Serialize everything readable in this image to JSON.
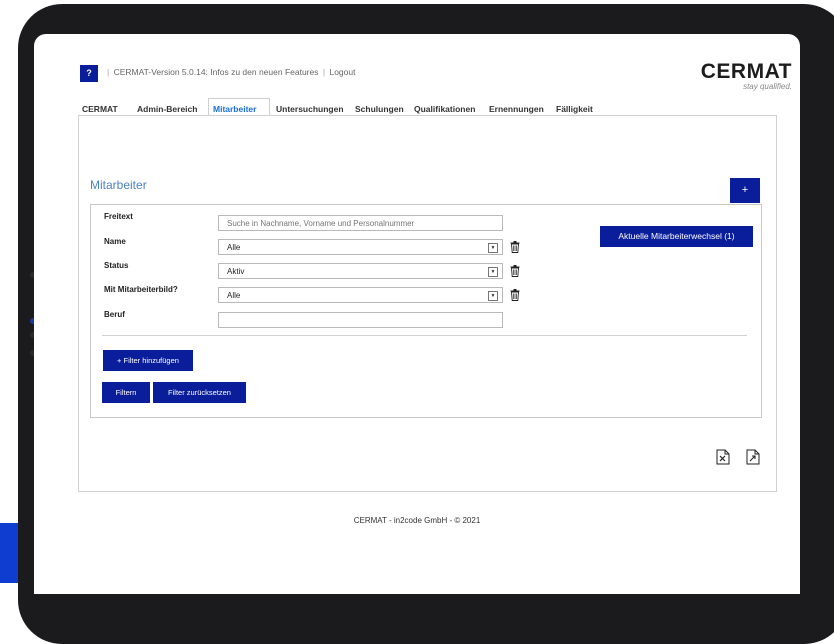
{
  "header": {
    "help_label": "?",
    "version_text": "CERMAT-Version 5.0.14: Infos zu den neuen Features",
    "logout_label": "Logout",
    "logo_text": "CERMAT",
    "logo_tagline": "stay qualified."
  },
  "tabs": [
    {
      "label": "CERMAT",
      "active": false
    },
    {
      "label": "Admin-Bereich",
      "active": false
    },
    {
      "label": "Mitarbeiter",
      "active": true
    },
    {
      "label": "Untersuchungen",
      "active": false
    },
    {
      "label": "Schulungen",
      "active": false
    },
    {
      "label": "Qualifikationen",
      "active": false
    },
    {
      "label": "Ernennungen",
      "active": false
    },
    {
      "label": "Fälligkeit",
      "active": false
    }
  ],
  "main": {
    "title": "Mitarbeiter",
    "add_label": "+",
    "wechsel_label": "Aktuelle Mitarbeiterwechsel (1)"
  },
  "filters": {
    "freitext": {
      "label": "Freitext",
      "placeholder": "Suche in Nachname, Vorname und Personalnummer",
      "value": ""
    },
    "name": {
      "label": "Name",
      "selected": "Alle"
    },
    "status": {
      "label": "Status",
      "selected": "Aktiv"
    },
    "bild": {
      "label": "Mit Mitarbeiterbild?",
      "selected": "Alle"
    },
    "beruf": {
      "label": "Beruf",
      "value": ""
    }
  },
  "actions": {
    "add_filter_label": "+ Filter hinzufügen",
    "filter_label": "Filtern",
    "reset_label": "Filter zurücksetzen"
  },
  "icons": {
    "trash": "trash-icon",
    "export_excel": "excel-export-icon",
    "export_file": "file-export-icon"
  },
  "colors": {
    "primary": "#0a1e9c",
    "accent_text": "#4a82c6",
    "active_tab": "#1a6fd6"
  },
  "footer": {
    "text": "CERMAT - in2code GmbH - © 2021"
  }
}
